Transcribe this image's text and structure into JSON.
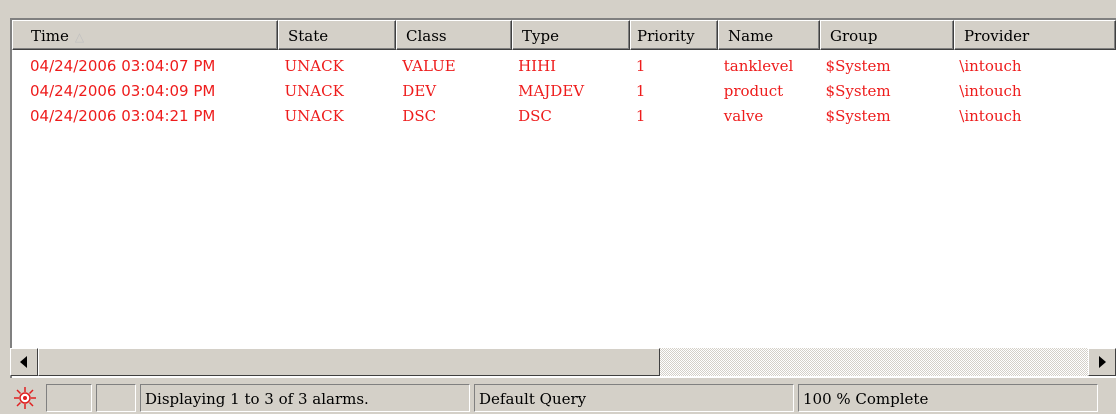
{
  "table": {
    "columns": [
      "Time",
      "State",
      "Class",
      "Type",
      "Priority",
      "Name",
      "Group",
      "Provider"
    ],
    "sort_indicator": "sort-ascending-icon",
    "rows": [
      [
        "04/24/2006 03:04:07 PM",
        "UNACK",
        "VALUE",
        "HIHI",
        "1",
        "tanklevel",
        "$System",
        "\\intouch"
      ],
      [
        "04/24/2006 03:04:09 PM",
        "UNACK",
        "DEV",
        "MAJDEV",
        "1",
        "product",
        "$System",
        "\\intouch"
      ],
      [
        "04/24/2006 03:04:21 PM",
        "UNACK",
        "DSC",
        "DSC",
        "1",
        "valve",
        "$System",
        "\\intouch"
      ]
    ],
    "row_color": "#ee1c1c"
  },
  "scrollbar": {
    "left_icon": "scroll-left-arrow-icon",
    "right_icon": "scroll-right-arrow-icon"
  },
  "status": {
    "indicator_icon": "alarm-light-icon",
    "message": "Displaying 1 to 3 of 3 alarms.",
    "query": "Default Query",
    "progress": "100 % Complete"
  }
}
